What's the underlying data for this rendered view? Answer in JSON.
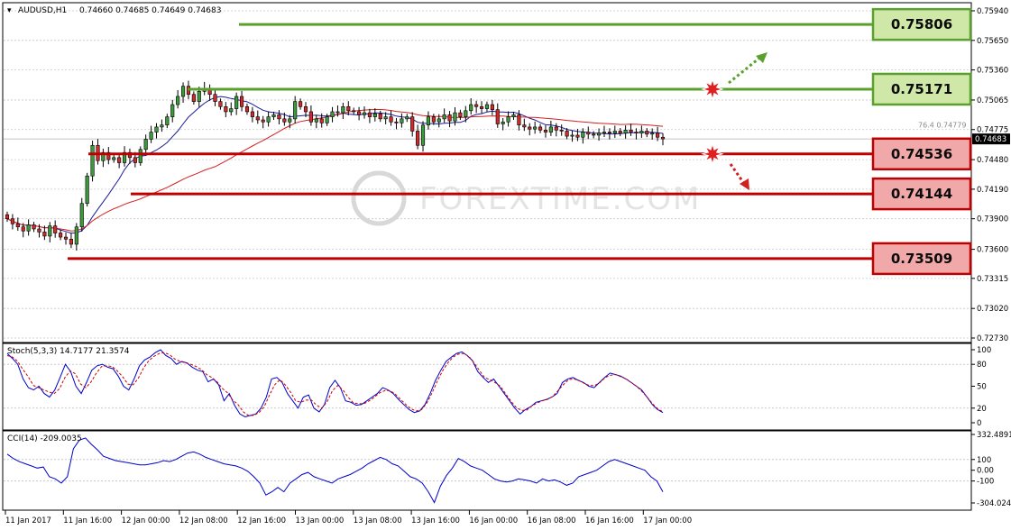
{
  "header": {
    "symbol": "AUDUSD,H1",
    "ohlc": "0.74660 0.74685 0.74649 0.74683"
  },
  "watermark": "FOREXTIME.COM",
  "chart_data": [
    {
      "type": "candlestick",
      "title": "AUDUSD,H1",
      "ylim": [
        0.7273,
        0.7594
      ],
      "y_ticks": [
        "0.75940",
        "0.75650",
        "0.75360",
        "0.75065",
        "0.74775",
        "0.74480",
        "0.74190",
        "0.73900",
        "0.73600",
        "0.73315",
        "0.73020",
        "0.72730"
      ],
      "x_ticks": [
        "11 Jan 2017",
        "11 Jan 16:00",
        "12 Jan 00:00",
        "12 Jan 08:00",
        "12 Jan 16:00",
        "13 Jan 00:00",
        "13 Jan 08:00",
        "13 Jan 16:00",
        "16 Jan 00:00",
        "16 Jan 08:00",
        "16 Jan 16:00",
        "17 Jan 00:00"
      ],
      "current_price": "0.74683",
      "fib_labels": [
        {
          "text": "76.4  0.74779",
          "value": 0.74779
        }
      ],
      "levels": [
        {
          "label": "0.75806",
          "value": 0.75806,
          "kind": "resistance",
          "color": "#5aa02c"
        },
        {
          "label": "0.75171",
          "value": 0.75171,
          "kind": "resistance",
          "color": "#5aa02c"
        },
        {
          "label": "0.74536",
          "value": 0.74536,
          "kind": "support",
          "color": "#c00000"
        },
        {
          "label": "0.74144",
          "value": 0.74144,
          "kind": "support",
          "color": "#c00000"
        },
        {
          "label": "0.73509",
          "value": 0.73509,
          "kind": "support",
          "color": "#c00000"
        }
      ],
      "closes": [
        0.739,
        0.7385,
        0.7382,
        0.7378,
        0.7384,
        0.738,
        0.7377,
        0.7373,
        0.7383,
        0.7376,
        0.7372,
        0.737,
        0.7365,
        0.7382,
        0.7405,
        0.7432,
        0.7462,
        0.7447,
        0.7455,
        0.7448,
        0.745,
        0.7445,
        0.7455,
        0.745,
        0.7445,
        0.7458,
        0.7468,
        0.7475,
        0.748,
        0.7482,
        0.749,
        0.7502,
        0.751,
        0.752,
        0.7512,
        0.7505,
        0.7515,
        0.7518,
        0.7512,
        0.7505,
        0.75,
        0.7495,
        0.7498,
        0.751,
        0.75,
        0.7495,
        0.749,
        0.7487,
        0.7485,
        0.749,
        0.7492,
        0.7488,
        0.7485,
        0.7488,
        0.7505,
        0.75,
        0.7495,
        0.7485,
        0.7488,
        0.7484,
        0.749,
        0.7495,
        0.7494,
        0.75,
        0.7496,
        0.7495,
        0.7492,
        0.7494,
        0.749,
        0.7493,
        0.7488,
        0.749,
        0.7485,
        0.7484,
        0.7488,
        0.749,
        0.7476,
        0.7462,
        0.7482,
        0.749,
        0.7485,
        0.7488,
        0.7492,
        0.7486,
        0.7494,
        0.749,
        0.7496,
        0.7502,
        0.75,
        0.7498,
        0.7502,
        0.7497,
        0.7483,
        0.7485,
        0.749,
        0.7492,
        0.7482,
        0.748,
        0.7478,
        0.748,
        0.7477,
        0.7475,
        0.748,
        0.7477,
        0.7476,
        0.7471,
        0.7472,
        0.747,
        0.7475,
        0.7473,
        0.7472,
        0.7474,
        0.7475,
        0.7474,
        0.7476,
        0.7474,
        0.7477,
        0.7475,
        0.7474,
        0.7476,
        0.7473,
        0.7474,
        0.747,
        0.74683
      ]
    },
    {
      "type": "line",
      "title": "Stoch(5,3,3) 14.7177 21.3574",
      "ylim": [
        0,
        100
      ],
      "y_ticks": [
        "100",
        "80",
        "50",
        "20",
        "0"
      ],
      "series": [
        {
          "name": "main",
          "color": "#0000cc",
          "values": [
            95,
            88,
            80,
            60,
            48,
            45,
            50,
            40,
            35,
            45,
            62,
            80,
            70,
            50,
            40,
            55,
            72,
            78,
            80,
            76,
            74,
            64,
            50,
            45,
            60,
            78,
            86,
            90,
            96,
            100,
            92,
            88,
            80,
            84,
            82,
            76,
            72,
            70,
            56,
            60,
            52,
            30,
            40,
            24,
            12,
            8,
            10,
            12,
            20,
            35,
            60,
            62,
            55,
            40,
            30,
            20,
            35,
            38,
            20,
            15,
            25,
            48,
            58,
            48,
            30,
            28,
            24,
            25,
            30,
            35,
            40,
            48,
            45,
            40,
            32,
            25,
            18,
            14,
            16,
            25,
            40,
            58,
            72,
            84,
            90,
            95,
            97,
            92,
            85,
            70,
            62,
            55,
            60,
            50,
            40,
            30,
            20,
            12,
            18,
            22,
            28,
            30,
            32,
            35,
            40,
            55,
            60,
            62,
            58,
            55,
            50,
            48,
            55,
            62,
            68,
            66,
            64,
            60,
            55,
            50,
            45,
            35,
            25,
            18,
            14
          ]
        },
        {
          "name": "signal",
          "color": "#cc0000",
          "values": [
            92,
            90,
            84,
            73,
            63,
            51,
            48,
            45,
            42,
            40,
            47,
            62,
            71,
            67,
            53,
            48,
            56,
            68,
            77,
            78,
            77,
            71,
            63,
            53,
            52,
            61,
            75,
            85,
            91,
            95,
            96,
            93,
            87,
            84,
            82,
            80,
            77,
            73,
            66,
            62,
            56,
            47,
            41,
            31,
            25,
            15,
            10,
            10,
            14,
            22,
            38,
            52,
            59,
            52,
            42,
            30,
            28,
            31,
            31,
            24,
            20,
            29,
            44,
            51,
            45,
            35,
            27,
            26,
            26,
            30,
            35,
            41,
            44,
            44,
            39,
            32,
            25,
            19,
            16,
            18,
            27,
            41,
            57,
            71,
            82,
            90,
            94,
            95,
            91,
            82,
            72,
            62,
            59,
            55,
            50,
            40,
            30,
            21,
            17,
            17,
            23,
            27,
            30,
            32,
            36,
            44,
            52,
            59,
            60,
            58,
            54,
            51,
            51,
            55,
            62,
            65,
            66,
            63,
            60,
            55,
            50,
            43,
            35,
            26,
            19,
            15
          ]
        }
      ]
    },
    {
      "type": "line",
      "title": "CCI(14) -209.0035",
      "ylim": [
        -304.0243,
        332.4891
      ],
      "y_ticks": [
        "332.4891",
        "100",
        "0.00",
        "-100",
        "-304.0243"
      ],
      "series": [
        {
          "name": "CCI",
          "color": "#0000cc",
          "values": [
            150,
            110,
            80,
            60,
            40,
            20,
            30,
            -60,
            -80,
            -120,
            -60,
            200,
            280,
            300,
            240,
            190,
            130,
            110,
            90,
            80,
            70,
            60,
            50,
            50,
            60,
            70,
            90,
            80,
            100,
            130,
            160,
            170,
            150,
            120,
            100,
            80,
            60,
            50,
            40,
            20,
            -10,
            -60,
            -120,
            -230,
            -200,
            -160,
            -200,
            -120,
            -80,
            -40,
            -20,
            -60,
            -80,
            -100,
            -120,
            -80,
            -60,
            -40,
            -10,
            20,
            60,
            90,
            120,
            100,
            60,
            40,
            -10,
            -60,
            -80,
            -120,
            -200,
            -300,
            -150,
            -50,
            20,
            110,
            80,
            40,
            20,
            0,
            -40,
            -80,
            -100,
            -110,
            -100,
            -80,
            -90,
            -100,
            -120,
            -80,
            -100,
            -90,
            -110,
            -140,
            -120,
            -60,
            -40,
            -20,
            0,
            40,
            80,
            100,
            80,
            60,
            40,
            20,
            0,
            -60,
            -100,
            -200
          ]
        }
      ]
    }
  ]
}
